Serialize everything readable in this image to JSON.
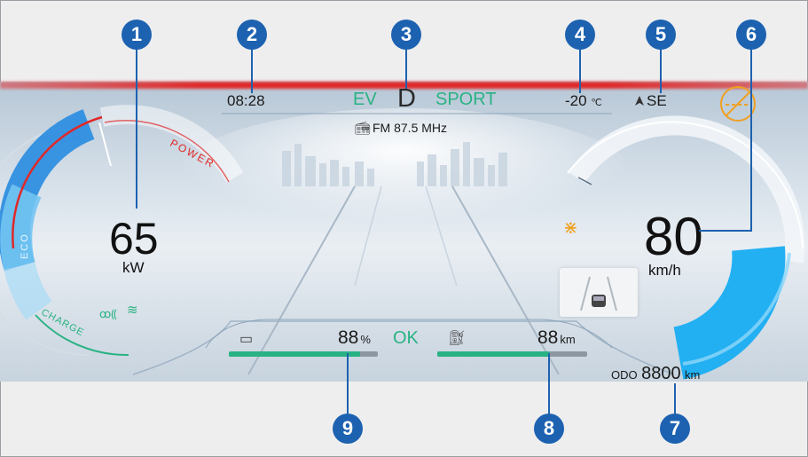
{
  "markers": [
    "1",
    "2",
    "3",
    "4",
    "5",
    "6",
    "7",
    "8",
    "9"
  ],
  "header": {
    "time": "08:28",
    "drive_mode": "EV",
    "gear": "D",
    "sport_mode": "SPORT",
    "temperature": "-20",
    "temperature_unit": "℃",
    "heading": "SE",
    "radio": "FM 87.5  MHz"
  },
  "power_gauge": {
    "value": "65",
    "unit": "kW",
    "label_power": "POWER",
    "label_eco": "ECO",
    "label_charge": "CHARGE",
    "level": 0.55
  },
  "speed_gauge": {
    "value": "80",
    "unit": "km/h",
    "level": 0.42
  },
  "battery": {
    "value": "88",
    "unit": "%",
    "level": 0.88
  },
  "status": "OK",
  "range": {
    "value": "88",
    "unit": "km",
    "level": 0.75
  },
  "odometer": {
    "label": "ODO",
    "value": "8800",
    "unit": "km"
  },
  "colors": {
    "accent": "#1d62b0",
    "green": "#29b283",
    "red": "#e02828",
    "blue_gauge": "#2c8ce0",
    "warning": "#f0a020"
  }
}
